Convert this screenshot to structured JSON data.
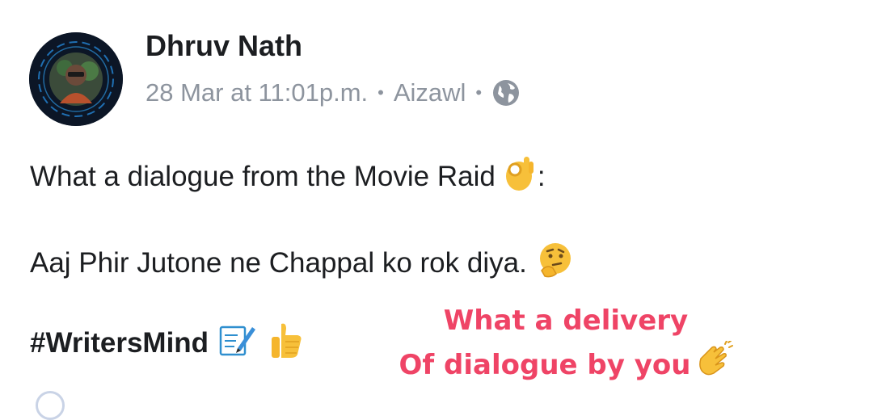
{
  "post": {
    "author": "Dhruv Nath",
    "date": "28 Mar at 11:01p.m.",
    "separator": "•",
    "location": "Aizawl",
    "privacy_icon": "globe-icon",
    "line1_text": "What a dialogue from the Movie Raid",
    "line1_suffix": ":",
    "line1_emoji": "ok-hand-emoji",
    "line2_text": "Aaj Phir Jutone ne Chappal ko rok diya.",
    "line2_emoji": "thinking-face-emoji",
    "hashtag": "#WritersMind",
    "hashtag_emojis": [
      "memo-emoji",
      "thumbs-up-emoji"
    ]
  },
  "overlay": {
    "line1": "What a delivery",
    "line2": "Of dialogue by you",
    "emoji": "clapping-hands-emoji",
    "color": "#ef4466"
  },
  "colors": {
    "text": "#1c1e21",
    "meta": "#8d949e",
    "emoji_yellow": "#f7c03a"
  }
}
